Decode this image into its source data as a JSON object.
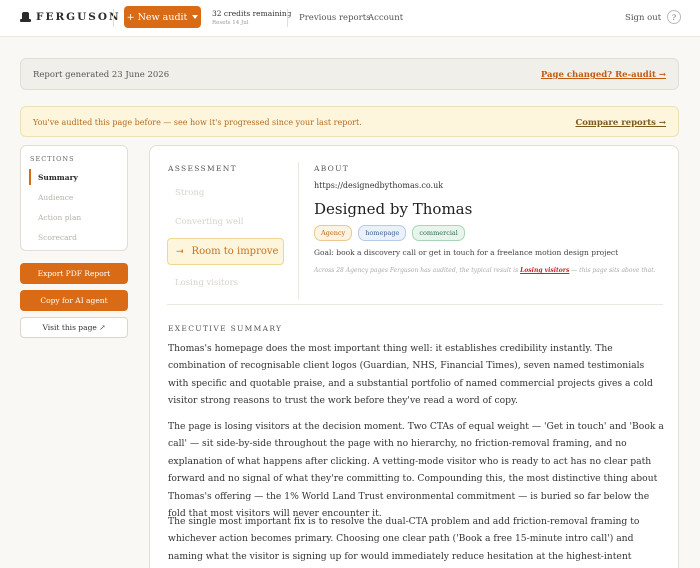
{
  "brand": {
    "name": "FERGUSON",
    "icon": "top-hat-icon"
  },
  "header": {
    "new_audit": "+ New audit",
    "credits": "32 credits remaining",
    "credits_reset": "Resets 14 Jul",
    "nav": [
      "Previous reports",
      "Account"
    ],
    "sign_out": "Sign out",
    "help": "?"
  },
  "report_bar": {
    "generated": "Report generated 23 June 2026",
    "reaudit": "Page changed? Re-audit →"
  },
  "audited_bar": {
    "message": "You've audited this page before — see how it's progressed since your last report.",
    "compare": "Compare reports →"
  },
  "sidebar": {
    "title": "SECTIONS",
    "items": [
      {
        "label": "Summary",
        "active": true
      },
      {
        "label": "Audience",
        "active": false
      },
      {
        "label": "Action plan",
        "active": false
      },
      {
        "label": "Scorecard",
        "active": false
      }
    ],
    "export": "Export PDF Report",
    "copy": "Copy for AI agent",
    "visit": "Visit this page ↗"
  },
  "assessment": {
    "label": "ASSESSMENT",
    "options": [
      "Strong",
      "Converting well",
      "Room to improve",
      "Losing visitors"
    ],
    "selected": "Room to improve"
  },
  "about": {
    "label": "ABOUT",
    "url": "https://designedbythomas.co.uk",
    "title": "Designed by Thomas",
    "tags": [
      "Agency",
      "homepage",
      "commercial"
    ],
    "goal": "Goal: book a discovery call or get in touch for a freelance motion design project",
    "note_prefix": "Across 28 Agency pages Ferguson has audited, the typical result is",
    "note_highlight": "Losing visitors",
    "note_suffix": "— this page sits above that."
  },
  "summary": {
    "label": "EXECUTIVE SUMMARY",
    "paragraphs": [
      "Thomas's homepage does the most important thing well: it establishes credibility instantly. The combination of recognisable client logos (Guardian, NHS, Financial Times), seven named testimonials with specific and quotable praise, and a substantial portfolio of named commercial projects gives a cold visitor strong reasons to trust the work before they've read a word of copy.",
      "The page is losing visitors at the decision moment. Two CTAs of equal weight — 'Get in touch' and 'Book a call' — sit side-by-side throughout the page with no hierarchy, no friction-removal framing, and no explanation of what happens after clicking. A vetting-mode visitor who is ready to act has no clear path forward and no signal of what they're committing to. Compounding this, the most distinctive thing about Thomas's offering — the 1% World Land Trust environmental commitment — is buried so far below the fold that most visitors will never encounter it.",
      "The single most important fix is to resolve the dual-CTA problem and add friction-removal framing to whichever action becomes primary. Choosing one clear path ('Book a free 15-minute intro call') and naming what the visitor is signing up for would immediately reduce hesitation at the highest-intent moment on the page — and that change requires nothing"
    ]
  },
  "colors": {
    "accent": "#d96b16",
    "warning_bg": "#fdf6dc",
    "danger": "#cc2222"
  }
}
